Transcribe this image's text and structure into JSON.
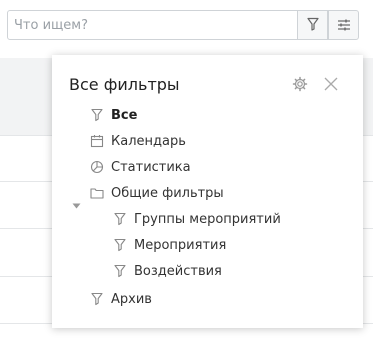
{
  "search": {
    "placeholder": "Что ищем?",
    "value": ""
  },
  "panel": {
    "title": "Все фильтры",
    "items": [
      {
        "label": "Все",
        "icon": "filter-icon",
        "active": true
      },
      {
        "label": "Календарь",
        "icon": "calendar-icon"
      },
      {
        "label": "Статистика",
        "icon": "pie-chart-icon"
      },
      {
        "label": "Общие фильтры",
        "icon": "folder-icon",
        "expanded": true
      },
      {
        "label": "Группы мероприятий",
        "icon": "filter-icon"
      },
      {
        "label": "Мероприятия",
        "icon": "filter-icon"
      },
      {
        "label": "Воздействия",
        "icon": "filter-icon"
      },
      {
        "label": "Архив",
        "icon": "filter-icon"
      }
    ]
  }
}
